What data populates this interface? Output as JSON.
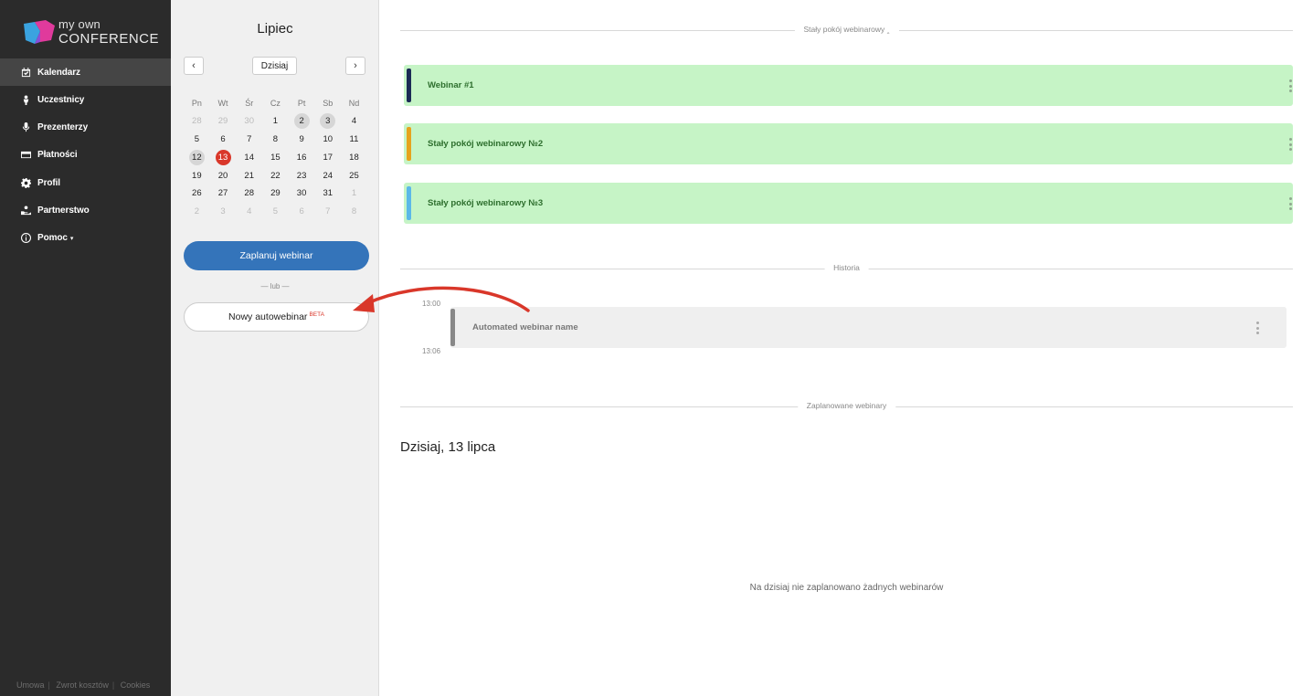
{
  "brand": {
    "line1": "my own",
    "line2": "CONFERENCE",
    "colors": {
      "magenta": "#e03a9c",
      "blue": "#3aa3e0",
      "purple": "#8a4fd8"
    }
  },
  "sidebar": {
    "items": [
      {
        "label": "Kalendarz",
        "icon": "calendar-icon",
        "active": true
      },
      {
        "label": "Uczestnicy",
        "icon": "person-icon"
      },
      {
        "label": "Prezenterzy",
        "icon": "microphone-icon"
      },
      {
        "label": "Płatności",
        "icon": "card-icon"
      },
      {
        "label": "Profil",
        "icon": "gear-icon"
      },
      {
        "label": "Partnerstwo",
        "icon": "handshake-icon"
      },
      {
        "label": "Pomoc",
        "icon": "info-icon",
        "caret": "▾"
      }
    ],
    "footer": [
      "Umowa",
      "Zwrot kosztów",
      "Cookies"
    ]
  },
  "calendar": {
    "month": "Lipiec",
    "prev_label": "‹",
    "next_label": "›",
    "today_label": "Dzisiaj",
    "weekdays": [
      "Pn",
      "Wt",
      "Śr",
      "Cz",
      "Pt",
      "Sb",
      "Nd"
    ],
    "weeks": [
      [
        {
          "d": "28",
          "m": true
        },
        {
          "d": "29",
          "m": true
        },
        {
          "d": "30",
          "m": true
        },
        {
          "d": "1"
        },
        {
          "d": "2",
          "mark": true
        },
        {
          "d": "3",
          "mark": true
        },
        {
          "d": "4"
        }
      ],
      [
        {
          "d": "5"
        },
        {
          "d": "6"
        },
        {
          "d": "7"
        },
        {
          "d": "8"
        },
        {
          "d": "9"
        },
        {
          "d": "10"
        },
        {
          "d": "11"
        }
      ],
      [
        {
          "d": "12",
          "mark": true
        },
        {
          "d": "13",
          "today": true
        },
        {
          "d": "14"
        },
        {
          "d": "15"
        },
        {
          "d": "16"
        },
        {
          "d": "17"
        },
        {
          "d": "18"
        }
      ],
      [
        {
          "d": "19"
        },
        {
          "d": "20"
        },
        {
          "d": "21"
        },
        {
          "d": "22"
        },
        {
          "d": "23"
        },
        {
          "d": "24"
        },
        {
          "d": "25"
        }
      ],
      [
        {
          "d": "26"
        },
        {
          "d": "27"
        },
        {
          "d": "28"
        },
        {
          "d": "29"
        },
        {
          "d": "30"
        },
        {
          "d": "31"
        },
        {
          "d": "1",
          "m": true
        }
      ],
      [
        {
          "d": "2",
          "m": true
        },
        {
          "d": "3",
          "m": true
        },
        {
          "d": "4",
          "m": true
        },
        {
          "d": "5",
          "m": true
        },
        {
          "d": "6",
          "m": true
        },
        {
          "d": "7",
          "m": true
        },
        {
          "d": "8",
          "m": true
        }
      ]
    ],
    "today_color": "#d9372a",
    "plan_button": "Zaplanuj webinar",
    "or_text": "— lub —",
    "auto_button": "Nowy autowebinar",
    "beta": "BETA"
  },
  "main": {
    "permanent_section": "Stały pokój webinarowy ‸",
    "rooms": [
      {
        "name": "Webinar #1",
        "color": "#1b2a55"
      },
      {
        "name": "Stały pokój webinarowy №2",
        "color": "#e6a31d"
      },
      {
        "name": "Stały pokój webinarowy №3",
        "color": "#5bb8e8"
      }
    ],
    "history_section": "Historia",
    "history": {
      "start": "13:00",
      "end": "13:06",
      "name": "Automated webinar name"
    },
    "scheduled_section": "Zaplanowane webinary",
    "today_heading": "Dzisiaj, 13 lipca",
    "empty_message": "Na dzisiaj nie zaplanowano żadnych webinarów"
  }
}
